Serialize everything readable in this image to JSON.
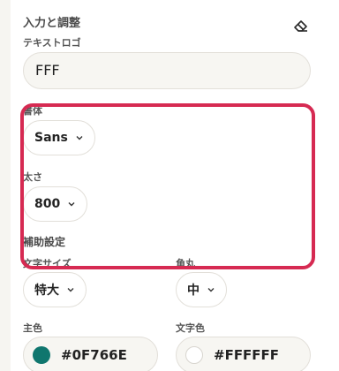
{
  "section": {
    "title": "入力と調整",
    "clear_icon": "eraser-icon"
  },
  "text_logo": {
    "label": "テキストロゴ",
    "value": "FFF"
  },
  "font": {
    "label": "書体",
    "selected": "Sans"
  },
  "weight": {
    "label": "太さ",
    "selected": "800"
  },
  "aux": {
    "title": "補助設定"
  },
  "font_size": {
    "label": "文字サイズ",
    "selected": "特大"
  },
  "corner": {
    "label": "角丸",
    "selected": "中"
  },
  "main_color": {
    "label": "主色",
    "value": "#0F766E",
    "swatch": "#0F766E"
  },
  "text_color": {
    "label": "文字色",
    "value": "#FFFFFF",
    "swatch": "#FFFFFF"
  },
  "colors": {
    "highlight": "#d62a52",
    "background": "#f6f5f1"
  }
}
